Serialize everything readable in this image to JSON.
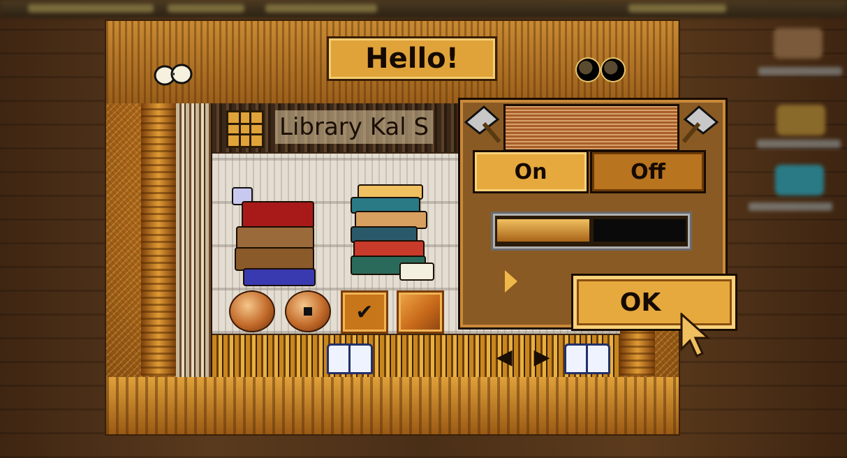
{
  "window": {
    "title": "Hello!",
    "toolbar_label": "Library Kal S"
  },
  "popup": {
    "on_label": "On",
    "off_label": "Off",
    "slider_value": 0.5,
    "ok_label": "OK"
  },
  "colors": {
    "frame_gold": "#e0a33a",
    "dark_outline": "#1a0c02",
    "panel_brown": "#8a5a24"
  },
  "icons": {
    "title_left": "glasses-icon",
    "title_right": "eyes-icon",
    "toolbar": "grid-icon",
    "nav_left": "arrow-left-icon",
    "nav_right": "arrow-right-icon",
    "book": "open-book-icon"
  }
}
